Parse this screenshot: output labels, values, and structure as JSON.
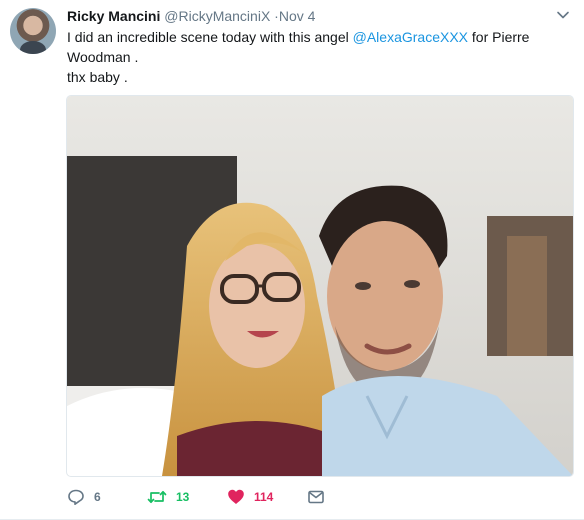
{
  "tweet": {
    "author_name": "Ricky Mancini",
    "author_handle": "@RickyManciniX",
    "timestamp": "Nov 4",
    "text_part1": "I did an incredible scene today with this angel ",
    "mention": "@AlexaGraceXXX",
    "text_part2": "  for Pierre Woodman .",
    "text_line2": "thx baby ."
  },
  "actions": {
    "reply_count": "6",
    "retweet_count": "13",
    "like_count": "114"
  },
  "icons": {
    "reply": "reply-icon",
    "retweet": "retweet-icon",
    "like": "heart-icon",
    "message": "envelope-icon",
    "caret": "chevron-down-icon"
  },
  "colors": {
    "mention": "#1b95e0",
    "retweet_active": "#17bf63",
    "like_active": "#e0245e",
    "secondary_text": "#657786"
  }
}
